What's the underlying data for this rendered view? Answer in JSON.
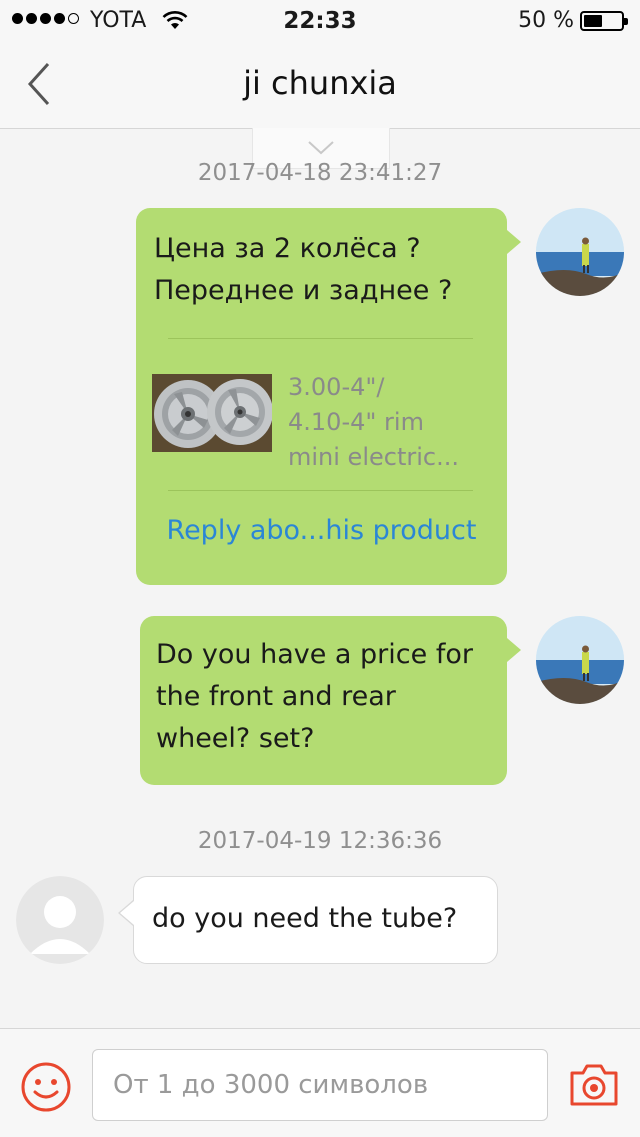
{
  "status_bar": {
    "carrier": "YOTA",
    "time": "22:33",
    "battery_percent_text": "50 %",
    "battery_level": 0.5
  },
  "nav": {
    "title": "ji chunxia"
  },
  "messages": [
    {
      "timestamp": "2017-04-18 23:41:27",
      "direction": "outgoing",
      "lines": [
        "Цена за 2 колёса ?",
        "Переднее и заднее ?"
      ],
      "product": {
        "title_lines": [
          "3.00-4\"/",
          "4.10-4\" rim",
          "mini electric..."
        ]
      },
      "reply_link": "Reply abo...his product"
    },
    {
      "direction": "outgoing",
      "lines": [
        "Do you have a price for",
        "the front and rear",
        "wheel? set?"
      ]
    },
    {
      "timestamp": "2017-04-19 12:36:36",
      "direction": "incoming",
      "lines": [
        "do you need the tube?"
      ]
    }
  ],
  "input": {
    "placeholder": "От 1 до 3000 символов"
  },
  "colors": {
    "outgoing_bubble": "#b3dc72",
    "incoming_bubble": "#ffffff",
    "accent": "#e8472e",
    "link": "#2b86d6"
  },
  "icons": [
    "back-chevron-icon",
    "wifi-icon",
    "battery-icon",
    "collapse-chevron-icon",
    "smiley-icon",
    "camera-icon"
  ]
}
